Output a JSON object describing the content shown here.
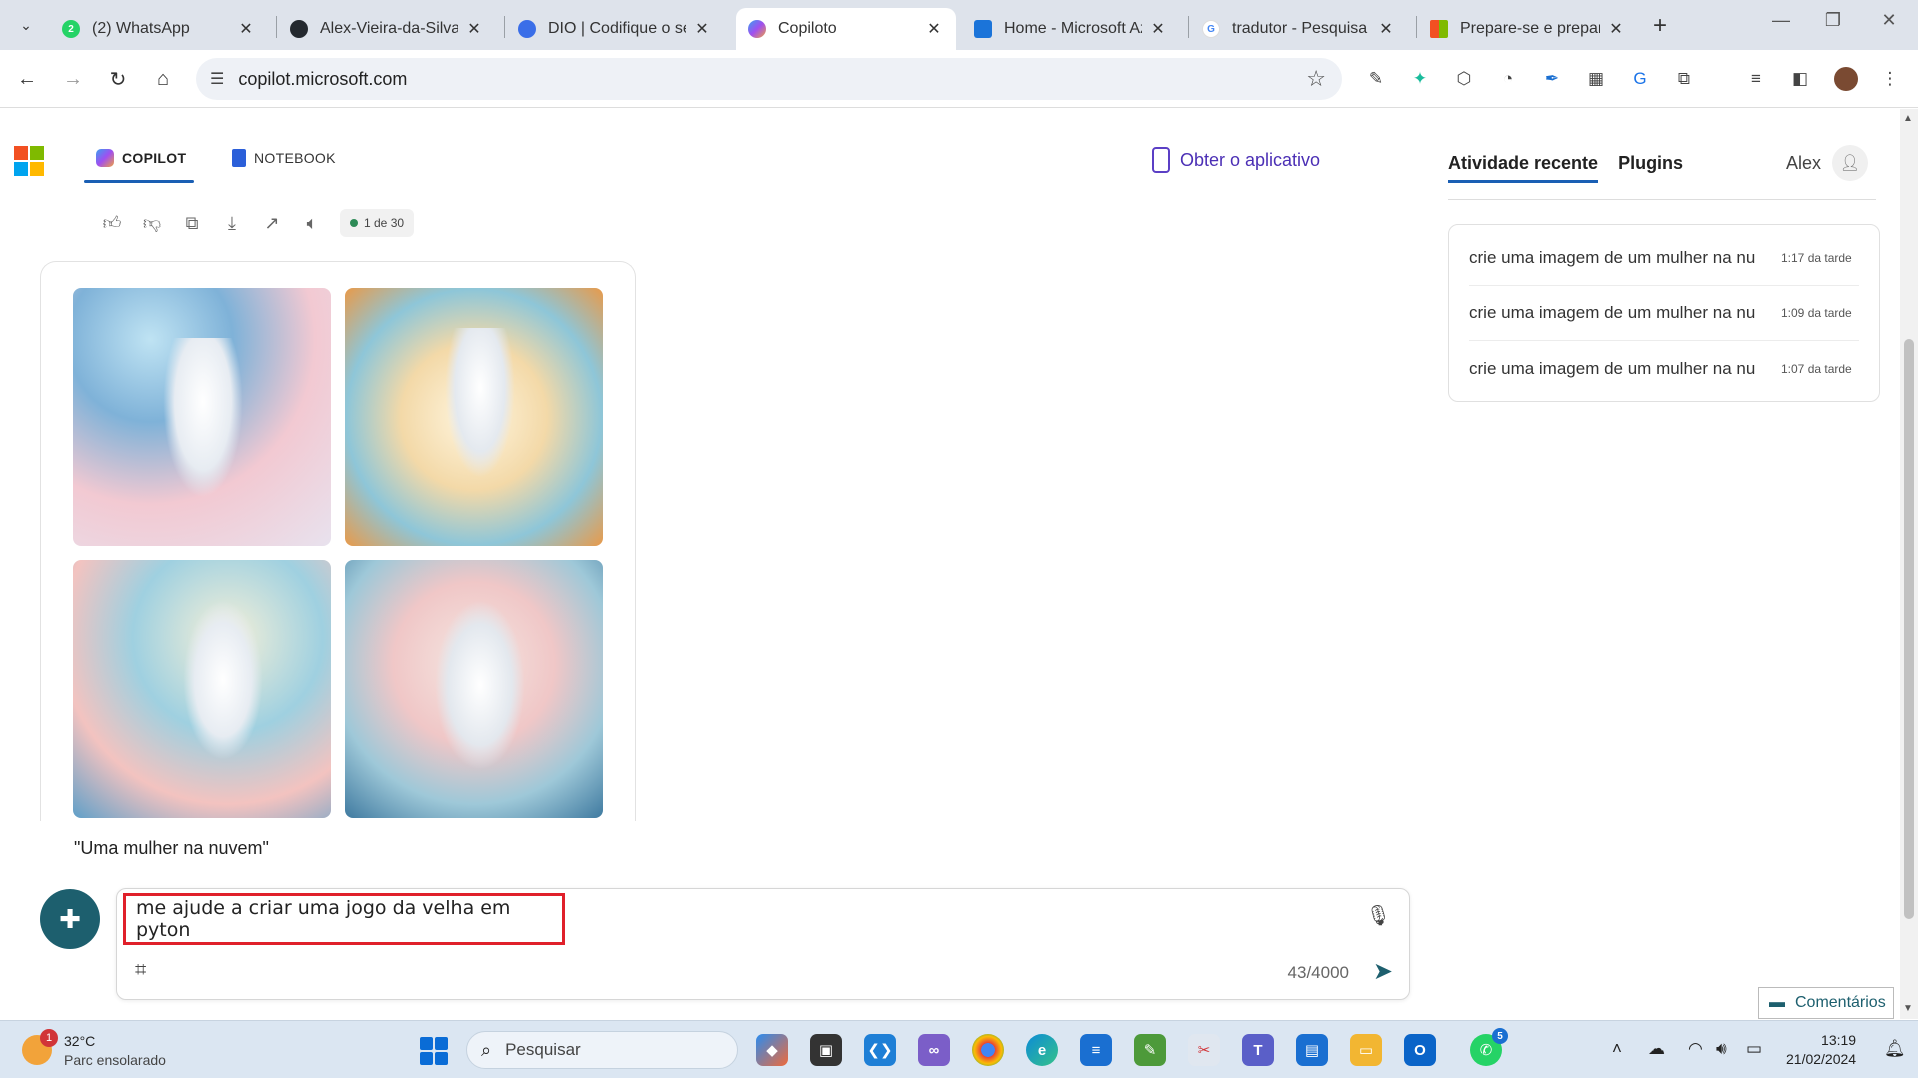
{
  "browser": {
    "tabs": [
      {
        "title": "(2) WhatsApp",
        "favicon": "whatsapp-icon",
        "color": "#25d366",
        "glyph": "2",
        "active": false
      },
      {
        "title": "Alex-Vieira-da-Silva/",
        "favicon": "github-icon",
        "color": "#24292f",
        "glyph": "",
        "active": false
      },
      {
        "title": "DIO | Codifique o seu",
        "favicon": "dio-icon",
        "color": "#3a6ee8",
        "glyph": "",
        "active": false
      },
      {
        "title": "Copiloto",
        "favicon": "copilot-icon",
        "color": "#7b5cf0",
        "glyph": "",
        "active": true
      },
      {
        "title": "Home - Microsoft Az",
        "favicon": "azure-icon",
        "color": "#1b74d9",
        "glyph": "",
        "active": false
      },
      {
        "title": "tradutor - Pesquisa G",
        "favicon": "google-icon",
        "color": "#4285f4",
        "glyph": "G",
        "active": false
      },
      {
        "title": "Prepare-se e prepare",
        "favicon": "microsoft-icon",
        "color": "#f25022",
        "glyph": "",
        "active": false
      }
    ],
    "url": "copilot.microsoft.com"
  },
  "header": {
    "nav": [
      {
        "label": "COPILOT",
        "active": true
      },
      {
        "label": "NOTEBOOK",
        "active": false
      }
    ],
    "get_app": "Obter o aplicativo"
  },
  "response": {
    "counter": "1 de 30",
    "caption": "\"Uma mulher na nuvem\""
  },
  "sidebar": {
    "tabs": [
      "Atividade recente",
      "Plugins"
    ],
    "user_name": "Alex",
    "recent": [
      {
        "text": "crie uma imagem de um mulher na nu",
        "time": "1:17 da tarde"
      },
      {
        "text": "crie uma imagem de um mulher na nu",
        "time": "1:09 da tarde"
      },
      {
        "text": "crie uma imagem de um mulher na nu",
        "time": "1:07 da tarde"
      }
    ]
  },
  "composer": {
    "value": "me ajude a criar uma jogo da velha em pyton",
    "char_count": "43/4000",
    "feedback": "Comentários"
  },
  "taskbar": {
    "weather_temp": "32°C",
    "weather_cond": "Parc ensolarado",
    "weather_badge": "1",
    "search_placeholder": "Pesquisar",
    "whatsapp_badge": "5",
    "time": "13:19",
    "date": "21/02/2024"
  },
  "colors": {
    "accent": "#1a5fb4",
    "teal": "#1d5f6e",
    "highlight_border": "#e0202a"
  }
}
